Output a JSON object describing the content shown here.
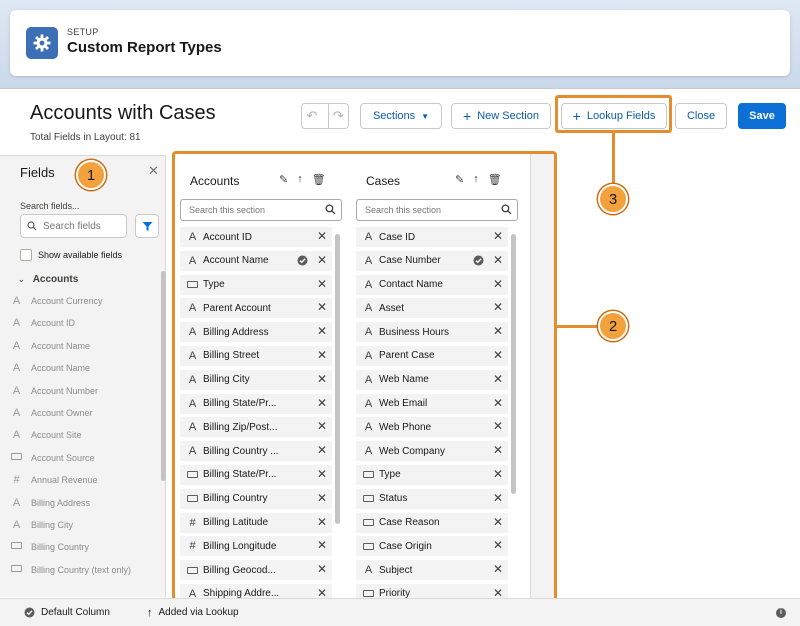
{
  "header": {
    "kicker": "SETUP",
    "title": "Custom Report Types"
  },
  "page": {
    "title": "Accounts with Cases",
    "total_fields": "Total Fields in Layout: 81"
  },
  "toolbar": {
    "sections_label": "Sections",
    "new_section_label": "New Section",
    "lookup_fields_label": "Lookup Fields",
    "close_label": "Close",
    "save_label": "Save"
  },
  "fields_panel": {
    "title": "Fields",
    "search_label": "Search fields...",
    "search_placeholder": "Search fields",
    "show_available_label": "Show available fields",
    "group_label": "Accounts",
    "items": [
      {
        "icon": "text-icon",
        "label": "Account Currency"
      },
      {
        "icon": "text-icon",
        "label": "Account ID"
      },
      {
        "icon": "text-icon",
        "label": "Account Name"
      },
      {
        "icon": "text-icon",
        "label": "Account Name"
      },
      {
        "icon": "text-icon",
        "label": "Account Number"
      },
      {
        "icon": "text-icon",
        "label": "Account Owner"
      },
      {
        "icon": "text-icon",
        "label": "Account Site"
      },
      {
        "icon": "picklist-icon",
        "label": "Account Source"
      },
      {
        "icon": "number-icon",
        "label": "Annual Revenue"
      },
      {
        "icon": "text-icon",
        "label": "Billing Address"
      },
      {
        "icon": "text-icon",
        "label": "Billing City"
      },
      {
        "icon": "picklist-icon",
        "label": "Billing Country"
      },
      {
        "icon": "picklist-icon",
        "label": "Billing Country (text only)"
      }
    ]
  },
  "sections": [
    {
      "title": "Accounts",
      "search_placeholder": "Search this section",
      "items": [
        {
          "icon": "text-icon",
          "label": "Account ID",
          "default": false
        },
        {
          "icon": "text-icon",
          "label": "Account Name",
          "default": true
        },
        {
          "icon": "picklist-icon",
          "label": "Type",
          "default": false
        },
        {
          "icon": "text-icon",
          "label": "Parent Account",
          "default": false
        },
        {
          "icon": "text-icon",
          "label": "Billing Address",
          "default": false
        },
        {
          "icon": "text-icon",
          "label": "Billing Street",
          "default": false
        },
        {
          "icon": "text-icon",
          "label": "Billing City",
          "default": false
        },
        {
          "icon": "text-icon",
          "label": "Billing State/Pr...",
          "default": false
        },
        {
          "icon": "text-icon",
          "label": "Billing Zip/Post...",
          "default": false
        },
        {
          "icon": "text-icon",
          "label": "Billing Country ...",
          "default": false
        },
        {
          "icon": "picklist-icon",
          "label": "Billing State/Pr...",
          "default": false
        },
        {
          "icon": "picklist-icon",
          "label": "Billing Country",
          "default": false
        },
        {
          "icon": "number-icon",
          "label": "Billing Latitude",
          "default": false
        },
        {
          "icon": "number-icon",
          "label": "Billing Longitude",
          "default": false
        },
        {
          "icon": "picklist-icon",
          "label": "Billing Geocod...",
          "default": false
        },
        {
          "icon": "text-icon",
          "label": "Shipping Addre...",
          "default": false
        }
      ]
    },
    {
      "title": "Cases",
      "search_placeholder": "Search this section",
      "items": [
        {
          "icon": "text-icon",
          "label": "Case ID",
          "default": false
        },
        {
          "icon": "text-icon",
          "label": "Case Number",
          "default": true
        },
        {
          "icon": "text-icon",
          "label": "Contact Name",
          "default": false
        },
        {
          "icon": "text-icon",
          "label": "Asset",
          "default": false
        },
        {
          "icon": "text-icon",
          "label": "Business Hours",
          "default": false
        },
        {
          "icon": "text-icon",
          "label": "Parent Case",
          "default": false
        },
        {
          "icon": "text-icon",
          "label": "Web Name",
          "default": false
        },
        {
          "icon": "text-icon",
          "label": "Web Email",
          "default": false
        },
        {
          "icon": "text-icon",
          "label": "Web Phone",
          "default": false
        },
        {
          "icon": "text-icon",
          "label": "Web Company",
          "default": false
        },
        {
          "icon": "picklist-icon",
          "label": "Type",
          "default": false
        },
        {
          "icon": "picklist-icon",
          "label": "Status",
          "default": false
        },
        {
          "icon": "picklist-icon",
          "label": "Case Reason",
          "default": false
        },
        {
          "icon": "picklist-icon",
          "label": "Case Origin",
          "default": false
        },
        {
          "icon": "text-icon",
          "label": "Subject",
          "default": false
        },
        {
          "icon": "picklist-icon",
          "label": "Priority",
          "default": false
        }
      ]
    }
  ],
  "callouts": [
    "1",
    "2",
    "3"
  ],
  "footer": {
    "default_column_label": "Default Column",
    "lookup_label": "Added via Lookup"
  },
  "colors": {
    "accent": "#0b6fd6",
    "callout": "#f2a13d",
    "highlight_border": "#e58d2c"
  }
}
